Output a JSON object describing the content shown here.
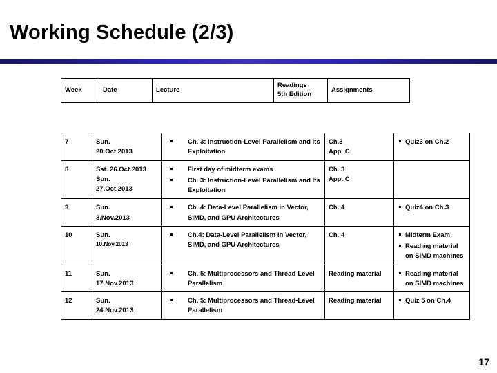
{
  "slide": {
    "title": "Working Schedule (2/3)",
    "page_number": "17",
    "accent_color": "#3c35ab",
    "rule_edge_color": "#171560"
  },
  "table": {
    "headers": {
      "week": "Week",
      "date": "Date",
      "lecture": "Lecture",
      "readings_line1": "Readings",
      "readings_line2": "5th Edition",
      "assignments": "Assignments"
    },
    "rows": [
      {
        "week": "7",
        "date_lines": [
          "Sun.",
          "20.Oct.2013"
        ],
        "date_small": false,
        "lecture": [
          "Ch. 3: Instruction-Level Parallelism and Its Exploitation"
        ],
        "readings": [
          "Ch.3",
          "App. C"
        ],
        "assignments": [
          "Quiz3 on Ch.2"
        ]
      },
      {
        "week": "8",
        "date_lines": [
          "Sat. 26.Oct.2013",
          "Sun.",
          "27.Oct.2013"
        ],
        "date_small": false,
        "lecture": [
          "First day of midterm exams",
          "Ch. 3: Instruction-Level Parallelism and Its Exploitation"
        ],
        "readings": [
          "Ch. 3",
          "App. C"
        ],
        "assignments": []
      },
      {
        "week": "9",
        "date_lines": [
          "Sun.",
          "3.Nov.2013"
        ],
        "date_small": false,
        "lecture": [
          "Ch. 4: Data-Level Parallelism in Vector, SIMD, and GPU Architectures"
        ],
        "readings": [
          "Ch. 4"
        ],
        "assignments": [
          "Quiz4 on Ch.3"
        ]
      },
      {
        "week": "10",
        "date_lines": [
          "Sun.",
          "10.Nov.2013"
        ],
        "date_small": true,
        "lecture": [
          "Ch.4: Data-Level Parallelism in Vector, SIMD, and GPU Architectures"
        ],
        "readings": [
          "Ch. 4"
        ],
        "assignments": [
          "Midterm Exam",
          "Reading material on SIMD machines"
        ]
      },
      {
        "week": "11",
        "date_lines": [
          "Sun.",
          "17.Nov.2013"
        ],
        "date_small": false,
        "lecture": [
          "Ch. 5: Multiprocessors and Thread-Level Parallelism"
        ],
        "readings": [
          "Reading material"
        ],
        "assignments": [
          "Reading material on SIMD machines"
        ]
      },
      {
        "week": "12",
        "date_lines": [
          "Sun.",
          "24.Nov.2013"
        ],
        "date_small": false,
        "lecture": [
          "Ch. 5: Multiprocessors and Thread-Level Parallelism"
        ],
        "readings": [
          "Reading material"
        ],
        "assignments": [
          "Quiz 5 on Ch.4"
        ]
      }
    ]
  }
}
